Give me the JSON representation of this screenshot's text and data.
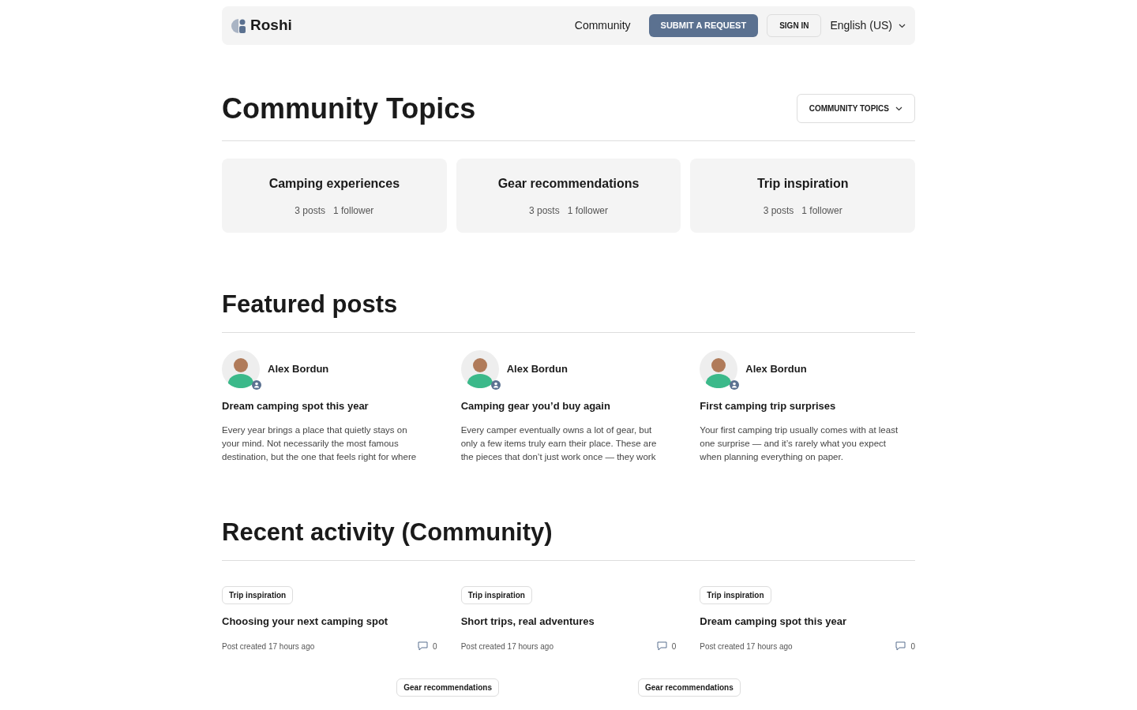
{
  "header": {
    "brand": "Roshi",
    "nav_link": "Community",
    "submit_button": "SUBMIT A REQUEST",
    "sign_in_button": "SIGN IN",
    "language": "English (US)"
  },
  "topics_section": {
    "title": "Community Topics",
    "dropdown": "COMMUNITY TOPICS",
    "topics": [
      {
        "title": "Camping experiences",
        "posts": "3 posts",
        "followers": "1 follower"
      },
      {
        "title": "Gear recommendations",
        "posts": "3 posts",
        "followers": "1 follower"
      },
      {
        "title": "Trip inspiration",
        "posts": "3 posts",
        "followers": "1 follower"
      }
    ]
  },
  "featured_section": {
    "title": "Featured posts",
    "posts": [
      {
        "author": "Alex Bordun",
        "title": "Dream camping spot this year",
        "excerpt": "Every year brings a place that quietly stays on your mind. Not necessarily the most famous destination, but the one that feels right for where"
      },
      {
        "author": "Alex Bordun",
        "title": "Camping gear you’d buy again",
        "excerpt": "Every camper eventually owns a lot of gear, but only a few items truly earn their place. These are the pieces that don’t just work once — they work"
      },
      {
        "author": "Alex Bordun",
        "title": "First camping trip surprises",
        "excerpt": "Your first camping trip usually comes with at least one surprise — and it’s rarely what you expect when planning everything on paper."
      }
    ]
  },
  "activity_section": {
    "title": "Recent activity (Community)",
    "items": [
      {
        "topic": "Trip inspiration",
        "title": "Choosing your next camping spot",
        "meta": "Post created 17 hours ago",
        "comments": "0"
      },
      {
        "topic": "Trip inspiration",
        "title": "Short trips, real adventures",
        "meta": "Post created 17 hours ago",
        "comments": "0"
      },
      {
        "topic": "Trip inspiration",
        "title": "Dream camping spot this year",
        "meta": "Post created 17 hours ago",
        "comments": "0"
      }
    ],
    "more_topics": [
      "Gear recommendations",
      "Gear recommendations"
    ]
  }
}
